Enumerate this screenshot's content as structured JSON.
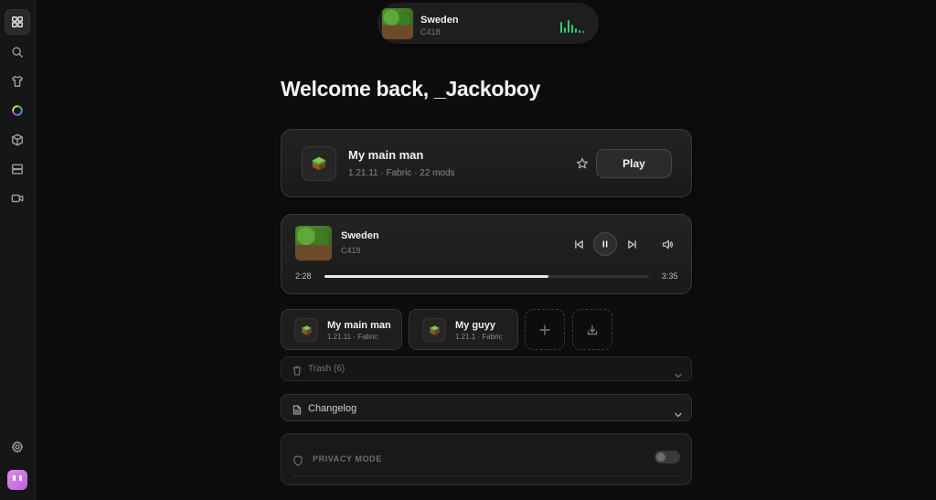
{
  "sidebar": {
    "items": [
      {
        "name": "home",
        "icon": "grid-icon",
        "active": true
      },
      {
        "name": "search",
        "icon": "search-icon"
      },
      {
        "name": "cosmetics",
        "icon": "shirt-icon"
      },
      {
        "name": "themes",
        "icon": "color-ring-icon"
      },
      {
        "name": "mods",
        "icon": "cube-icon"
      },
      {
        "name": "servers",
        "icon": "server-icon"
      },
      {
        "name": "recordings",
        "icon": "video-icon"
      }
    ],
    "bottom": [
      {
        "name": "settings",
        "icon": "gear-icon"
      },
      {
        "name": "profile",
        "icon": "avatar-icon"
      }
    ]
  },
  "now_playing": {
    "title": "Sweden",
    "artist": "C418",
    "elapsed": "2:28",
    "duration": "3:35",
    "progress": 0.69
  },
  "welcome": {
    "text": "Welcome back, _Jackoboy"
  },
  "featured_profile": {
    "name": "My main man",
    "meta": "1.21.11 · Fabric · 22 mods",
    "play_label": "Play"
  },
  "instances": [
    {
      "name": "My main man",
      "meta": "1.21.11 · Fabric"
    },
    {
      "name": "My guyy",
      "meta": "1.21.1 · Fabric"
    }
  ],
  "trash": {
    "label": "Trash (6)"
  },
  "changelog": {
    "label": "Changelog"
  },
  "privacy": {
    "label": "PRIVACY MODE",
    "enabled": false
  },
  "colors": {
    "accent_green": "#2ecc71",
    "background": "#0d0d0d",
    "avatar": "#d97be6"
  }
}
